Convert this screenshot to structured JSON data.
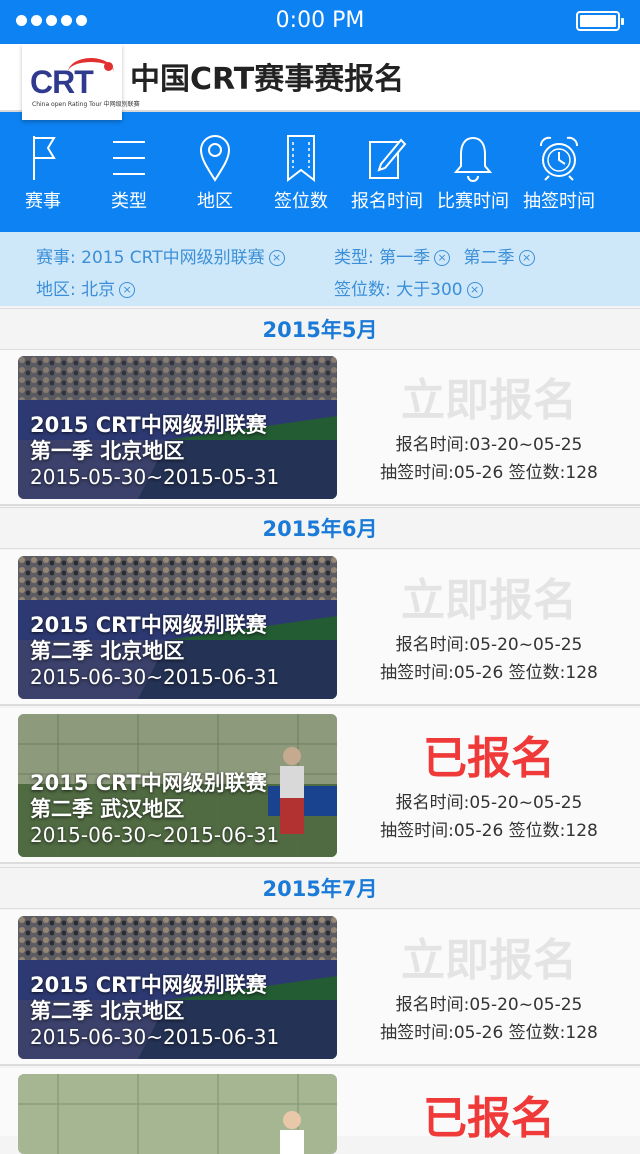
{
  "status_bar": {
    "time": "0:00 PM"
  },
  "header": {
    "title": "中国CRT赛事赛报名",
    "logo_text": "CRT",
    "logo_sub": "China open Rating Tour 中网级别联赛"
  },
  "toolbar": {
    "items": [
      {
        "label": "赛事",
        "icon": "flag-icon"
      },
      {
        "label": "类型",
        "icon": "menu-icon"
      },
      {
        "label": "地区",
        "icon": "location-pin-icon"
      },
      {
        "label": "签位数",
        "icon": "bookmark-icon"
      },
      {
        "label": "报名时间",
        "icon": "edit-icon"
      },
      {
        "label": "比赛时间",
        "icon": "bell-icon"
      },
      {
        "label": "抽签时间",
        "icon": "alarm-clock-icon"
      }
    ]
  },
  "filters": {
    "event": "赛事: 2015 CRT中网级别联赛",
    "type_label": "类型: 第一季",
    "type_extra": "第二季",
    "region": "地区: 北京",
    "draw_size": "签位数: 大于300",
    "remove_glyph": "×"
  },
  "sections": [
    {
      "month": "2015年5月"
    },
    {
      "month": "2015年6月"
    },
    {
      "month": "2015年7月"
    }
  ],
  "cards": [
    {
      "title": "2015 CRT中网级别联赛",
      "subtitle": "第一季  北京地区",
      "dates": "2015-05-30~2015-05-31",
      "status": "立即报名",
      "status_type": "open",
      "signup_time": "报名时间:03-20~05-25",
      "draw_info": "抽签时间:05-26  签位数:128",
      "image": "tennis-stadium"
    },
    {
      "title": "2015 CRT中网级别联赛",
      "subtitle": "第二季  北京地区",
      "dates": "2015-06-30~2015-06-31",
      "status": "立即报名",
      "status_type": "open",
      "signup_time": "报名时间:05-20~05-25",
      "draw_info": "抽签时间:05-26  签位数:128",
      "image": "tennis-stadium"
    },
    {
      "title": "2015 CRT中网级别联赛",
      "subtitle": "第二季  武汉地区",
      "dates": "2015-06-30~2015-06-31",
      "status": "已报名",
      "status_type": "done",
      "signup_time": "报名时间:05-20~05-25",
      "draw_info": "抽签时间:05-26  签位数:128",
      "image": "tennis-player"
    },
    {
      "title": "2015 CRT中网级别联赛",
      "subtitle": "第二季  北京地区",
      "dates": "2015-06-30~2015-06-31",
      "status": "立即报名",
      "status_type": "open",
      "signup_time": "报名时间:05-20~05-25",
      "draw_info": "抽签时间:05-26  签位数:128",
      "image": "tennis-stadium"
    },
    {
      "status": "已报名",
      "status_type": "done",
      "image": "tennis-player"
    }
  ],
  "colors": {
    "accent": "#0d82f2",
    "filter_bg": "#cfe8f9",
    "registered": "#f03a3a",
    "open_disabled": "#e4e4e4",
    "month_text": "#1a7ad8"
  }
}
